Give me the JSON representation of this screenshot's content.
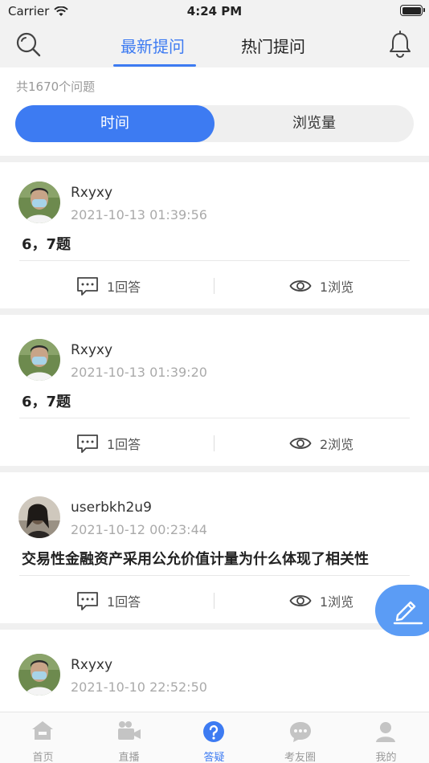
{
  "status_bar": {
    "carrier": "Carrier",
    "time": "4:24 PM"
  },
  "header": {
    "tabs": [
      {
        "label": "最新提问",
        "active": true
      },
      {
        "label": "热门提问",
        "active": false
      }
    ],
    "search_icon": "search-icon",
    "bell_icon": "bell-icon"
  },
  "count_text": "共1670个问题",
  "sort": {
    "options": [
      "时间",
      "浏览量"
    ],
    "selected": "时间"
  },
  "questions": [
    {
      "user": "Rxyxy",
      "time": "2021-10-13 01:39:56",
      "title": "6，7题",
      "answers": "1回答",
      "views": "1浏览"
    },
    {
      "user": "Rxyxy",
      "time": "2021-10-13 01:39:20",
      "title": "6，7题",
      "answers": "1回答",
      "views": "2浏览"
    },
    {
      "user": "userbkh2u9",
      "time": "2021-10-12 00:23:44",
      "title": "交易性金融资产采用公允价值计量为什么体现了相关性",
      "answers": "1回答",
      "views": "1浏览"
    },
    {
      "user": "Rxyxy",
      "time": "2021-10-10 22:52:50",
      "title": "",
      "answers": "",
      "views": ""
    }
  ],
  "tabbar": {
    "items": [
      {
        "label": "首页",
        "icon": "home-icon"
      },
      {
        "label": "直播",
        "icon": "video-icon"
      },
      {
        "label": "答疑",
        "icon": "question-icon",
        "active": true
      },
      {
        "label": "考友圈",
        "icon": "chat-icon"
      },
      {
        "label": "我的",
        "icon": "profile-icon"
      }
    ]
  },
  "colors": {
    "accent": "#3d7bf2",
    "fab": "#5b9cf5"
  }
}
